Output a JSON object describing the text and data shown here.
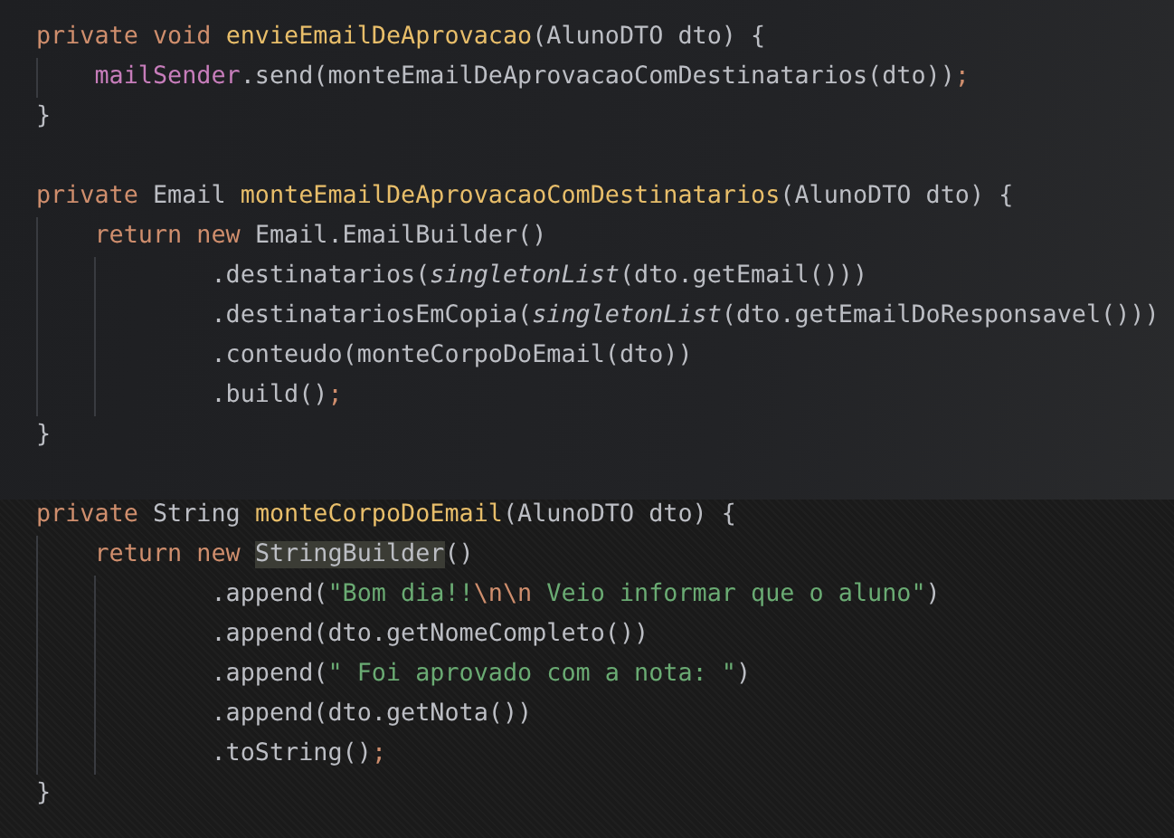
{
  "editor": {
    "lines": [
      {
        "kind": "code",
        "tokens": [
          {
            "kind": "keyword",
            "text": "private void "
          },
          {
            "kind": "method",
            "text": "envieEmailDeAprovacao"
          },
          {
            "kind": "plain",
            "text": "(AlunoDTO dto) {"
          }
        ]
      },
      {
        "kind": "code",
        "tokens": [
          {
            "kind": "field",
            "text": "    mailSender"
          },
          {
            "kind": "plain",
            "text": ".send(monteEmailDeAprovacaoComDestinatarios(dto))"
          },
          {
            "kind": "semicolon",
            "text": ";"
          }
        ]
      },
      {
        "kind": "code",
        "tokens": [
          {
            "kind": "plain",
            "text": "}"
          }
        ]
      },
      {
        "kind": "blank"
      },
      {
        "kind": "code",
        "tokens": [
          {
            "kind": "keyword",
            "text": "private "
          },
          {
            "kind": "plain",
            "text": "Email "
          },
          {
            "kind": "method",
            "text": "monteEmailDeAprovacaoComDestinatarios"
          },
          {
            "kind": "plain",
            "text": "(AlunoDTO dto) {"
          }
        ]
      },
      {
        "kind": "code",
        "tokens": [
          {
            "kind": "keyword",
            "text": "    return new "
          },
          {
            "kind": "plain",
            "text": "Email.EmailBuilder()"
          }
        ]
      },
      {
        "kind": "code",
        "tokens": [
          {
            "kind": "plain",
            "text": "            .destinatarios("
          },
          {
            "kind": "static",
            "text": "singletonList"
          },
          {
            "kind": "plain",
            "text": "(dto.getEmail()))"
          }
        ]
      },
      {
        "kind": "code",
        "tokens": [
          {
            "kind": "plain",
            "text": "            .destinatariosEmCopia("
          },
          {
            "kind": "static",
            "text": "singletonList"
          },
          {
            "kind": "plain",
            "text": "(dto.getEmailDoResponsavel()))"
          }
        ]
      },
      {
        "kind": "code",
        "tokens": [
          {
            "kind": "plain",
            "text": "            .conteudo(monteCorpoDoEmail(dto))"
          }
        ]
      },
      {
        "kind": "code",
        "tokens": [
          {
            "kind": "plain",
            "text": "            .build()"
          },
          {
            "kind": "semicolon",
            "text": ";"
          }
        ]
      },
      {
        "kind": "code",
        "tokens": [
          {
            "kind": "plain",
            "text": "}"
          }
        ]
      },
      {
        "kind": "blank"
      },
      {
        "kind": "code",
        "tokens": [
          {
            "kind": "keyword",
            "text": "private "
          },
          {
            "kind": "plain",
            "text": "String "
          },
          {
            "kind": "method",
            "text": "monteCorpoDoEmail"
          },
          {
            "kind": "plain",
            "text": "(AlunoDTO dto) {"
          }
        ]
      },
      {
        "kind": "code",
        "tokens": [
          {
            "kind": "keyword",
            "text": "    return new "
          },
          {
            "kind": "plain",
            "text": "StringBuilder",
            "highlighted": true
          },
          {
            "kind": "plain",
            "text": "()"
          }
        ]
      },
      {
        "kind": "code",
        "tokens": [
          {
            "kind": "plain",
            "text": "            .append("
          },
          {
            "kind": "string",
            "text": "\"Bom dia!!"
          },
          {
            "kind": "escape",
            "text": "\\n\\n"
          },
          {
            "kind": "string",
            "text": " Veio informar que o aluno\""
          },
          {
            "kind": "plain",
            "text": ")"
          }
        ]
      },
      {
        "kind": "code",
        "tokens": [
          {
            "kind": "plain",
            "text": "            .append(dto.getNomeCompleto())"
          }
        ]
      },
      {
        "kind": "code",
        "tokens": [
          {
            "kind": "plain",
            "text": "            .append("
          },
          {
            "kind": "string",
            "text": "\" Foi aprovado com a nota: \""
          },
          {
            "kind": "plain",
            "text": ")"
          }
        ]
      },
      {
        "kind": "code",
        "tokens": [
          {
            "kind": "plain",
            "text": "            .append(dto.getNota())"
          }
        ]
      },
      {
        "kind": "code",
        "tokens": [
          {
            "kind": "plain",
            "text": "            .toString()"
          },
          {
            "kind": "semicolon",
            "text": ";"
          }
        ]
      },
      {
        "kind": "code",
        "tokens": [
          {
            "kind": "plain",
            "text": "}"
          }
        ]
      }
    ]
  }
}
